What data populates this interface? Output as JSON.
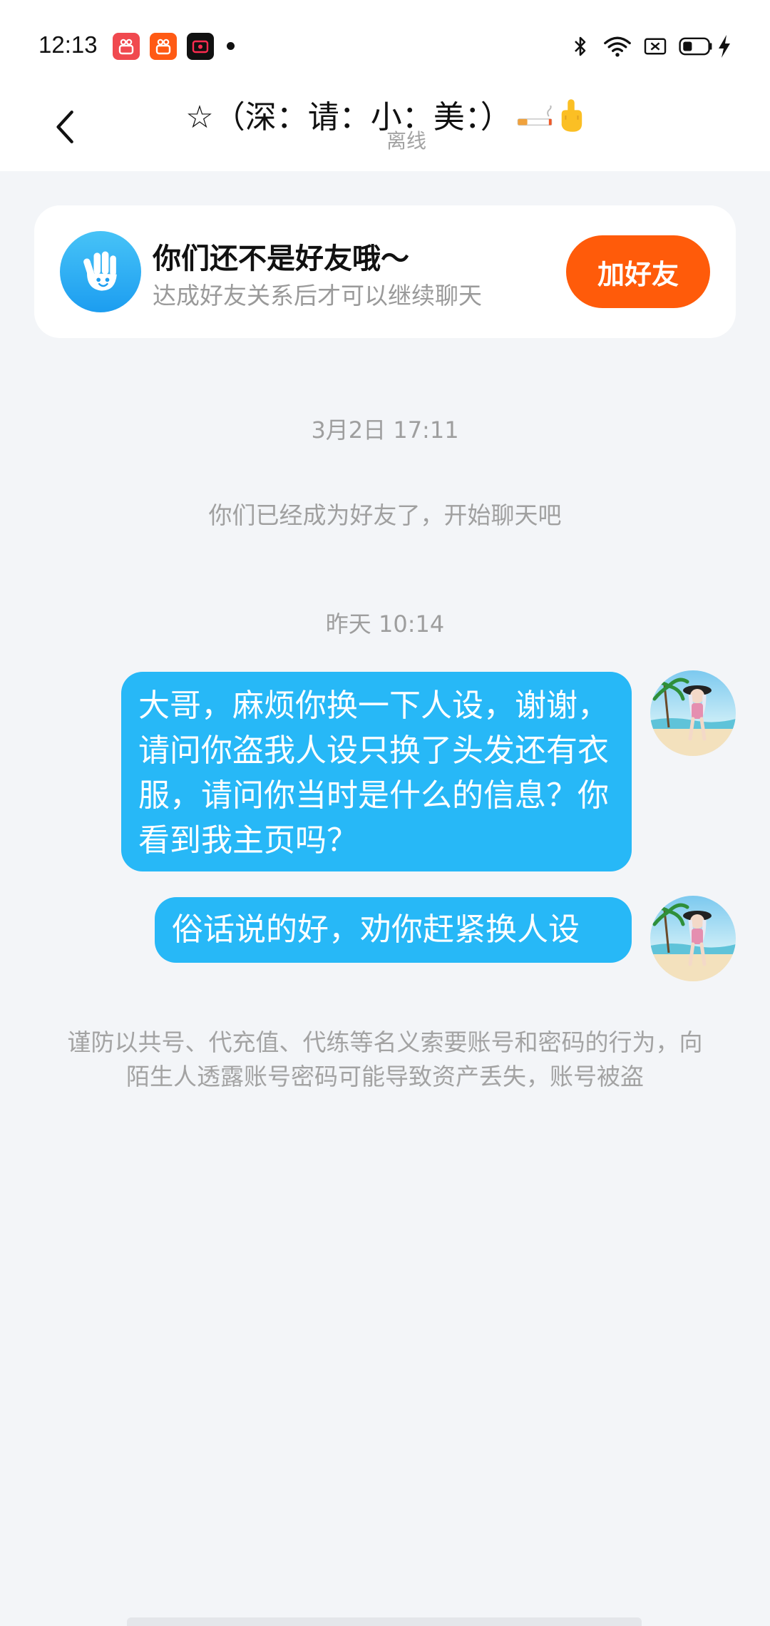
{
  "status_bar": {
    "time": "12:13",
    "apps": [
      "kuaishou-icon",
      "kuaishou-icon",
      "video-recorder-icon"
    ],
    "icons": [
      "bluetooth-icon",
      "wifi-icon",
      "sim-icon",
      "battery-icon",
      "charging-icon"
    ]
  },
  "header": {
    "title": "☆（深：请：小：美：）",
    "title_emoji": [
      "cigarette-icon",
      "middle-finger-icon"
    ],
    "status": "离线"
  },
  "friend_banner": {
    "title": "你们还不是好友哦～",
    "subtitle": "达成好友关系后才可以继续聊天",
    "button_label": "加好友"
  },
  "chat": {
    "timestamp_1": "3月2日 17:11",
    "system_message": "你们已经成为好友了，开始聊天吧",
    "timestamp_2": "昨天 10:14",
    "messages": [
      {
        "text": "大哥，麻烦你换一下人设，谢谢，请问你盗我人设只换了头发还有衣服，请问你当时是什么的信息？你看到我主页吗？",
        "sender": "self"
      },
      {
        "text": "俗话说的好，劝你赶紧换人设",
        "sender": "self"
      }
    ],
    "warning": "谨防以共号、代充值、代练等名义索要账号和密码的行为，向陌生人透露账号密码可能导致资产丢失，账号被盗"
  },
  "colors": {
    "bubble": "#27b8f7",
    "accent_button": "#ff5b0a",
    "background": "#f3f5f8"
  }
}
